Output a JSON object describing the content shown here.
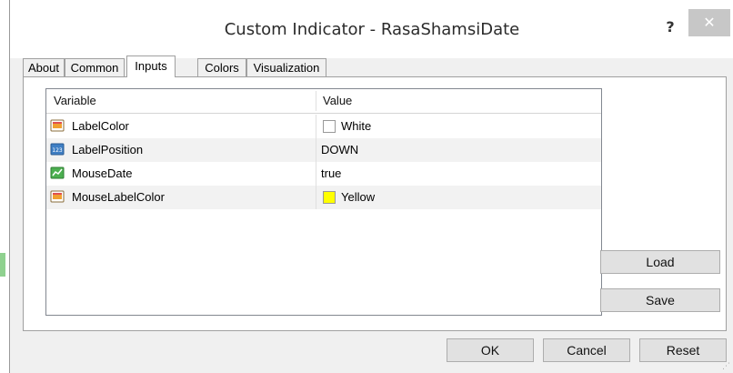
{
  "window": {
    "title": "Custom Indicator - RasaShamsiDate",
    "help_label": "?",
    "close_label": "✕"
  },
  "tabs": [
    {
      "label": "About",
      "active": false
    },
    {
      "label": "Common",
      "active": false
    },
    {
      "label": "Inputs",
      "active": true
    },
    {
      "label": "Colors",
      "active": false
    },
    {
      "label": "Visualization",
      "active": false
    }
  ],
  "table": {
    "headers": {
      "variable": "Variable",
      "value": "Value"
    },
    "rows": [
      {
        "variable": "LabelColor",
        "value": "White",
        "icon": "color-param-icon",
        "swatch": "#ffffff"
      },
      {
        "variable": "LabelPosition",
        "value": "DOWN",
        "icon": "enum-param-icon",
        "swatch": null
      },
      {
        "variable": "MouseDate",
        "value": "true",
        "icon": "bool-param-icon",
        "swatch": null
      },
      {
        "variable": "MouseLabelColor",
        "value": "Yellow",
        "icon": "color-param-icon",
        "swatch": "#ffff00"
      }
    ]
  },
  "side_buttons": {
    "load": "Load",
    "save": "Save"
  },
  "footer_buttons": {
    "ok": "OK",
    "cancel": "Cancel",
    "reset": "Reset"
  },
  "colors": {
    "selected_row": "#f2f2f2",
    "close_button": "#c7c7c7"
  }
}
